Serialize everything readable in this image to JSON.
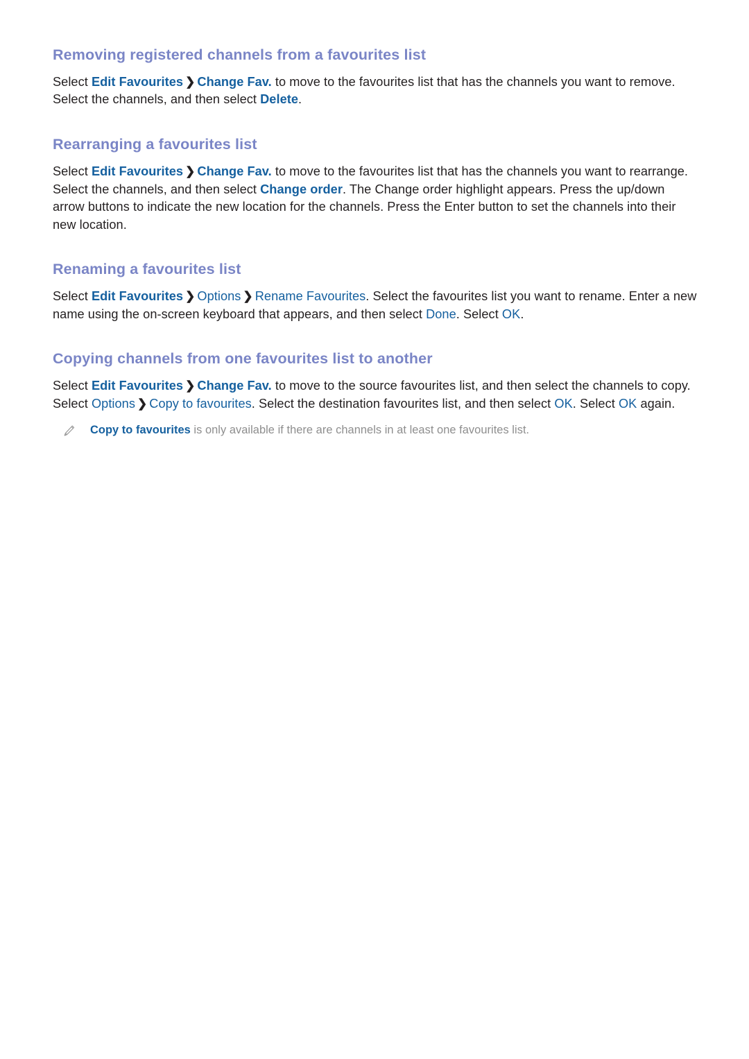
{
  "page": {
    "background": "#ffffff",
    "heading_color": "#7a85c6",
    "link_color": "#15609f",
    "body_color": "#231f20",
    "note_color": "#8e8e8e"
  },
  "sections": [
    {
      "id": "removing-registered-channels",
      "heading": "Removing registered channels from a favourites list",
      "paragraph": {
        "t1": "Select ",
        "l1": "Edit Favourites",
        "sep1": "❯",
        "l2": "Change Fav.",
        "t2": " to move to the favourites list that has the channels you want to remove. Select the channels, and then select ",
        "l3": "Delete",
        "t3": "."
      }
    },
    {
      "id": "rearranging-favourites-list",
      "heading": "Rearranging a favourites list",
      "paragraph": {
        "t1": "Select ",
        "l1": "Edit Favourites",
        "sep1": "❯",
        "l2": "Change Fav.",
        "t2": " to move to the favourites list that has the channels you want to rearrange. Select the channels, and then select ",
        "l3": "Change order",
        "t3": ". The Change order highlight appears. Press the up/down arrow buttons to indicate the new location for the channels. Press the Enter button to set the channels into their new location."
      }
    },
    {
      "id": "renaming-favourites-list",
      "heading": "Renaming a favourites list",
      "paragraph": {
        "t1": "Select ",
        "l1": "Edit Favourites",
        "sep1": "❯",
        "l2": "Options",
        "sep2": "❯",
        "l3": "Rename Favourites",
        "t2": ". Select the favourites list you want to rename. Enter a new name using the on-screen keyboard that appears, and then select ",
        "l4": "Done",
        "t3": ". Select ",
        "l5": "OK",
        "t4": "."
      }
    },
    {
      "id": "copying-channels-between-lists",
      "heading": "Copying channels from one favourites list to another",
      "paragraph": {
        "t1": "Select ",
        "l1": "Edit Favourites",
        "sep1": "❯",
        "l2": "Change Fav.",
        "t2": " to move to the source favourites list, and then select the channels to copy. Select ",
        "l3": "Options",
        "sep2": "❯",
        "l4": "Copy to favourites",
        "t3": ". Select the destination favourites list, and then select ",
        "l5": "OK",
        "t4": ". Select ",
        "l6": "OK",
        "t5": " again."
      },
      "note": {
        "icon": "pencil-icon",
        "link": "Copy to favourites",
        "text": " is only available if there are channels in at least one favourites list."
      }
    }
  ]
}
